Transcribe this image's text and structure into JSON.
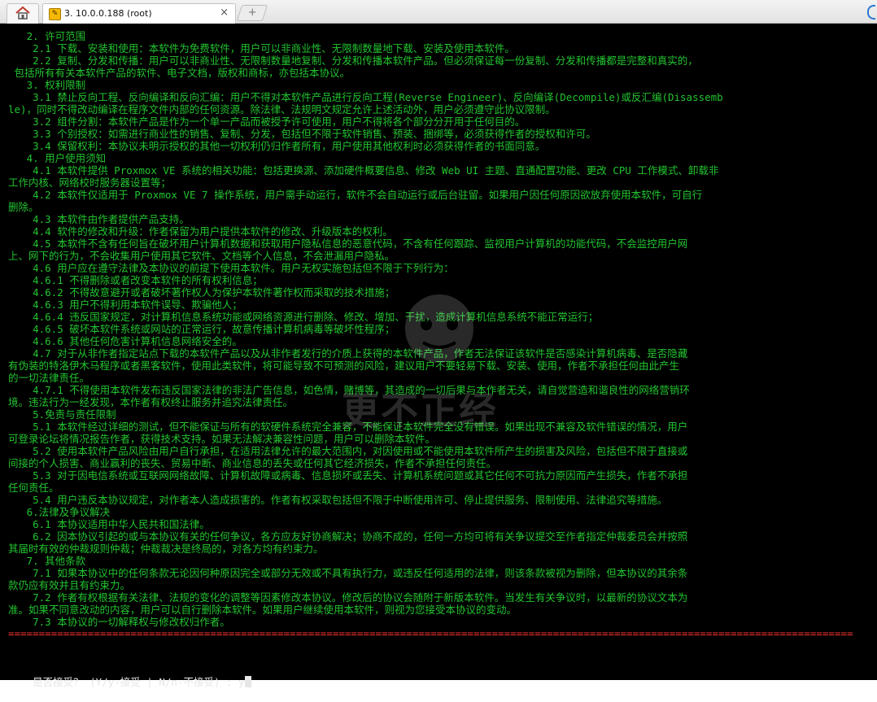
{
  "tabs": {
    "home_label": "Home",
    "session_title": "3. 10.0.0.188 (root)",
    "close_symbol": "×",
    "new_tab_symbol": "+"
  },
  "terminal": {
    "lines": [
      "   2. 许可范围",
      "    2.1 下载、安装和使用：本软件为免费软件，用户可以非商业性、无限制数量地下载、安装及使用本软件。",
      "    2.2 复制、分发和传播：用户可以非商业性、无限制数量地复制、分发和传播本软件产品。但必须保证每一份复制、分发和传播都是完整和真实的，",
      " 包括所有有关本软件产品的软件、电子文档，版权和商标，亦包括本协议。",
      "   3. 权利限制",
      "    3.1 禁止反向工程、反向编译和反向汇编：用户不得对本软件产品进行反向工程(Reverse Engineer)、反向编译(Decompile)或反汇编(Disassemb",
      "le)，同时不得改动编译在程序文件内部的任何资源。除法律、法规明文规定允许上述活动外，用户必须遵守此协议限制。",
      "    3.2 组件分割：本软件产品是作为一个单一产品而被授予许可使用，用户不得将各个部分分开用于任何目的。",
      "    3.3 个别授权：如需进行商业性的销售、复制、分发，包括但不限于软件销售、预装、捆绑等，必须获得作者的授权和许可。",
      "    3.4 保留权利：本协议未明示授权的其他一切权利仍归作者所有，用户使用其他权利时必须获得作者的书面同意。",
      "   4. 用户使用须知",
      "    4.1 本软件提供 Proxmox VE 系统的相关功能：包括更换源、添加硬件概要信息、修改 Web UI 主题、直通配置功能、更改 CPU 工作模式、卸载非",
      "工作内核、网络校时服务器设置等；",
      "    4.2 本软件仅适用于 Proxmox VE 7 操作系统，用户需手动运行，软件不会自动运行或后台驻留。如果用户因任何原因欲放弃使用本软件，可自行",
      "删除。",
      "    4.3 本软件由作者提供产品支持。",
      "    4.4 软件的修改和升级：作者保留为用户提供本软件的修改、升级版本的权利。",
      "    4.5 本软件不含有任何旨在破坏用户计算机数据和获取用户隐私信息的恶意代码，不含有任何跟踪、监视用户计算机的功能代码，不会监控用户网",
      "上、网下的行为，不会收集用户使用其它软件、文档等个人信息，不会泄漏用户隐私。",
      "    4.6 用户应在遵守法律及本协议的前提下使用本软件。用户无权实施包括但不限于下列行为：",
      "    4.6.1 不得删除或者改变本软件的所有权利信息；",
      "    4.6.2 不得故意避开或者破坏著作权人为保护本软件著作权而采取的技术措施；",
      "    4.6.3 用户不得利用本软件误导、欺骗他人；",
      "    4.6.4 违反国家规定，对计算机信息系统功能或网络资源进行删除、修改、增加、干扰，造成计算机信息系统不能正常运行；",
      "    4.6.5 破坏本软件系统或网站的正常运行，故意传播计算机病毒等破坏性程序；",
      "    4.6.6 其他任何危害计算机信息网络安全的。",
      "    4.7 对于从非作者指定站点下载的本软件产品以及从非作者发行的介质上获得的本软件产品，作者无法保证该软件是否感染计算机病毒、是否隐藏",
      "有伪装的特洛伊木马程序或者黑客软件，使用此类软件，将可能导致不可预测的风险，建议用户不要轻易下载、安装、使用，作者不承担任何由此产生",
      "的一切法律责任。",
      "    4.7.1 不得使用本软件发布违反国家法律的非法广告信息，如色情，赌博等，其造成的一切后果与本作者无关，请自觉营造和谐良性的网络营销环",
      "境。违法行为一经发现，本作者有权终止服务并追究法律责任。",
      "    5.免责与责任限制",
      "    5.1 本软件经过详细的测试，但不能保证与所有的软硬件系统完全兼容，不能保证本软件完全没有错误。如果出现不兼容及软件错误的情况，用户",
      "可登录论坛将情况报告作者，获得技术支持。如果无法解决兼容性问题，用户可以删除本软件。",
      "    5.2 使用本软件产品风险由用户自行承担，在适用法律允许的最大范围内，对因使用或不能使用本软件所产生的损害及风险，包括但不限于直接或",
      "间接的个人损害、商业赢利的丧失、贸易中断、商业信息的丢失或任何其它经济损失，作者不承担任何责任。",
      "    5.3 对于因电信系统或互联网网络故障、计算机故障或病毒、信息损坏或丢失、计算机系统问题或其它任何不可抗力原因而产生损失，作者不承担",
      "任何责任。",
      "    5.4 用户违反本协议规定，对作者本人造成损害的。作者有权采取包括但不限于中断使用许可、停止提供服务、限制使用、法律追究等措施。",
      "   6.法律及争议解决",
      "    6.1 本协议适用中华人民共和国法律。",
      "    6.2 因本协议引起的或与本协议有关的任何争议，各方应友好协商解决；协商不成的，任何一方均可将有关争议提交至作者指定仲裁委员会并按照",
      "其届时有效的仲裁规则仲裁；仲裁裁决是终局的，对各方均有约束力。",
      "   7. 其他条款",
      "    7.1 如果本协议中的任何条款无论因何种原因完全或部分无效或不具有执行力，或违反任何适用的法律，则该条款被视为删除，但本协议的其余条",
      "款仍应有效并且有约束力。",
      "    7.2 作者有权根据有关法律、法规的变化的调整等因素修改本协议。修改后的协议会随附于新版本软件。当发生有关争议时，以最新的协议文本为",
      "准。如果不同意改动的内容，用户可以自行删除本软件。如果用户继续使用本软件，则视为您接受本协议的变动。",
      "    7.3 本协议的一切解释权与修改权归作者。"
    ],
    "divider": "==========================================================================================================================================",
    "prompt": "是否接受？ (Y/y-接受 | N/n-不接受) : ",
    "input_value": "y"
  },
  "watermark": {
    "text": "更不正经"
  },
  "colors": {
    "terminal_text": "#22c42f",
    "divider": "#ff3333",
    "prompt_text": "#e6e6e6",
    "background": "#000000"
  }
}
